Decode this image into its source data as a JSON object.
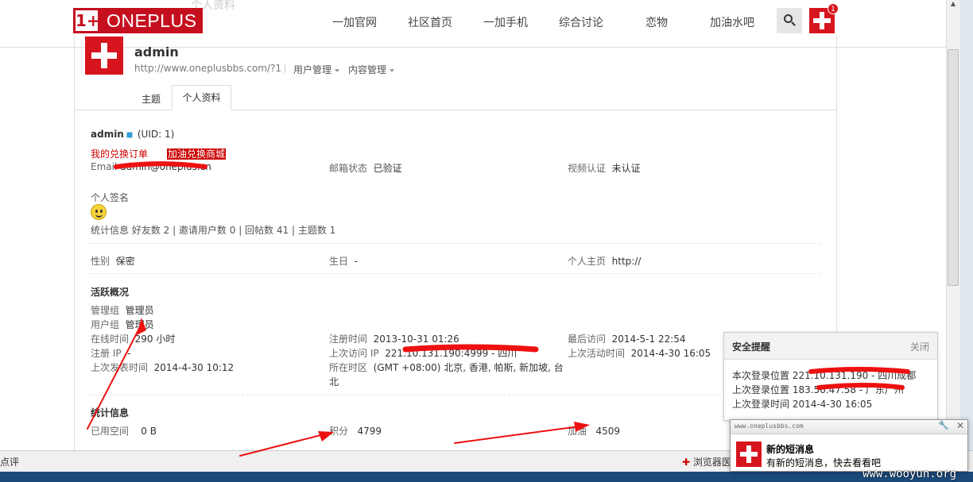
{
  "nav": {
    "brand": "ONEPLUS",
    "brand_mark": "1+",
    "ghost_title": "个人资料",
    "items": [
      "一加官网",
      "社区首页",
      "一加手机",
      "综合讨论",
      "恋物",
      "加油水吧"
    ],
    "notification_count": "1"
  },
  "header": {
    "username": "admin",
    "url": "http://www.oneplusbbs.com/?1",
    "user_menu": "用户管理",
    "content_menu": "内容管理"
  },
  "tabs": [
    "主题",
    "个人资料"
  ],
  "profile": {
    "name": "admin",
    "uid": "(UID: 1)",
    "order_link": "我的兑换订单",
    "mall_link": "加油兑换商城",
    "email_label": "Email",
    "email_value": "admin@oneplus.cn",
    "mail_status_label": "邮箱状态",
    "mail_status_value": "已验证",
    "video_label": "视频认证",
    "video_value": "未认证",
    "signature_label": "个人签名",
    "stats_line": "统计信息 好友数 2  |  邀请用户数 0  |  回帖数 41  |  主题数 1",
    "gender_label": "性别",
    "gender_value": "保密",
    "birthday_label": "生日",
    "birthday_value": "-",
    "homepage_label": "个人主页",
    "homepage_value": "http://"
  },
  "activity": {
    "title": "活跃概况",
    "admin_group_label": "管理组",
    "admin_group_value": "管理员",
    "user_group_label": "用户组",
    "user_group_value": "管理员",
    "online_label": "在线时间",
    "online_value": "290 小时",
    "reg_ip_label": "注册 IP",
    "reg_ip_value": "-",
    "last_post_label": "上次发表时间",
    "last_post_value": "2014-4-30 10:12",
    "reg_time_label": "注册时间",
    "reg_time_value": "2013-10-31 01:26",
    "last_ip_label": "上次访问 IP",
    "last_ip_value": "221.10.131.190:4999 - 四川",
    "timezone_label": "所在时区",
    "timezone_value": "(GMT +08:00) 北京, 香港, 帕斯, 新加坡, 台",
    "timezone_value2": "北",
    "last_visit_label": "最后访问",
    "last_visit_value": "2014-5-1 22:54",
    "last_active_label": "上次活动时间",
    "last_active_value": "2014-4-30 16:05"
  },
  "stats": {
    "title": "统计信息",
    "space_label": "已用空间",
    "space_value": "0 B",
    "points_label": "积分",
    "points_value": "4799",
    "fuel_label": "加油",
    "fuel_value": "4509"
  },
  "security": {
    "title": "安全提醒",
    "close": "关闭",
    "line1": "本次登录位置 221.10.131.190 - 四川成都",
    "line2": "上次登录位置 183.56.47.58 - 广东广州",
    "line3": "上次登录时间 2014-4-30 16:05"
  },
  "notification": {
    "site": "www.oneplusbbs.com",
    "title": "新的短消息",
    "body": "有新的短消息，快去看看吧"
  },
  "statusbar": {
    "left": "点评",
    "right": "浏览器医"
  },
  "watermark": "www.wooyun.org",
  "colors": {
    "brand_red": "#c50f1f",
    "link_red": "#cc0000",
    "annotation_red": "#ee1111"
  }
}
